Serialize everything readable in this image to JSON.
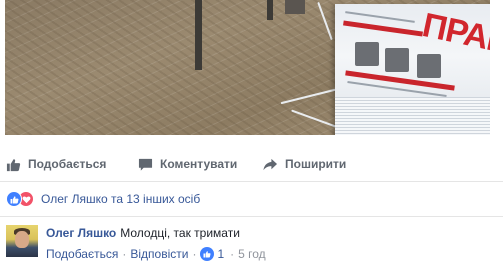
{
  "post": {
    "photo_icon": "newspaper-photo",
    "photo_headline": "ПРАВДА"
  },
  "actions": {
    "like_label": "Подобається",
    "comment_label": "Коментувати",
    "share_label": "Поширити",
    "like_icon": "thumbs-up-icon",
    "comment_icon": "speech-bubble-icon",
    "share_icon": "share-arrow-icon"
  },
  "reactions": {
    "summary": "Олег Ляшко та 13 інших осіб",
    "icons": [
      "like-reaction-icon",
      "love-reaction-icon"
    ],
    "like_color": "#4080ff",
    "love_color": "#f25268"
  },
  "comment": {
    "author": "Олег Ляшко",
    "text": "Молодці, так тримати",
    "like_label": "Подобається",
    "reply_label": "Відповісти",
    "separator": "·",
    "like_count": "1",
    "time": "5 год"
  },
  "colors": {
    "link": "#385898",
    "muted": "#606770",
    "meta": "#90949c"
  }
}
